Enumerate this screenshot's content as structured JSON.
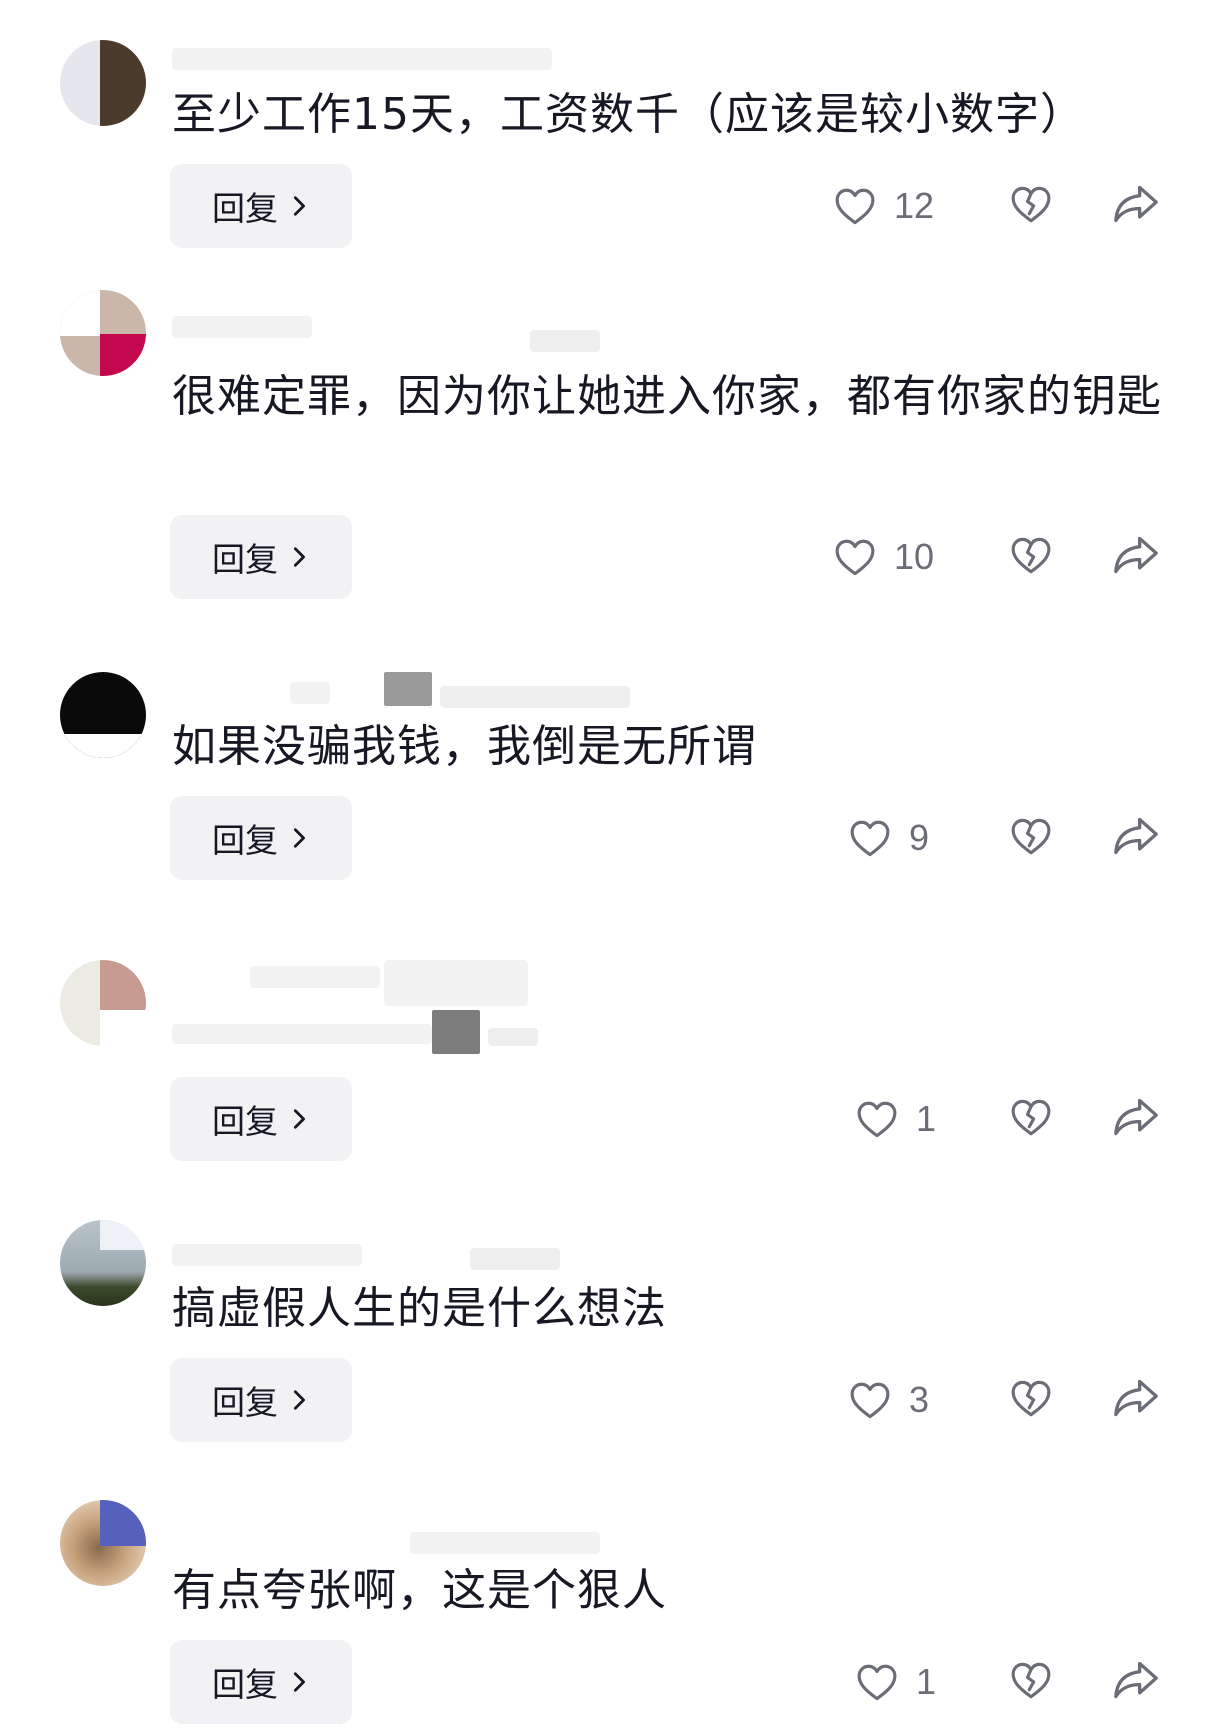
{
  "comments": [
    {
      "text": "至少工作15天，工资数千（应该是较小数字）",
      "reply_label": "回复",
      "likes": "12"
    },
    {
      "text": "很难定罪，因为你让她进入你家，都有你家的钥匙",
      "reply_label": "回复",
      "likes": "10"
    },
    {
      "text": "如果没骗我钱，我倒是无所谓",
      "reply_label": "回复",
      "likes": "9"
    },
    {
      "text": "",
      "reply_label": "回复",
      "likes": "1"
    },
    {
      "text": "搞虚假人生的是什么想法",
      "reply_label": "回复",
      "likes": "3"
    },
    {
      "text": "有点夸张啊，这是个狠人",
      "reply_label": "回复",
      "likes": "1"
    }
  ],
  "icons": {
    "like": "heart-outline-icon",
    "dislike": "broken-heart-icon",
    "share": "share-arrow-icon",
    "reply_chevron": "chevron-right-icon"
  },
  "colors": {
    "text": "#161823",
    "secondary": "#6b6d76",
    "reply_bg": "#f2f2f4"
  }
}
